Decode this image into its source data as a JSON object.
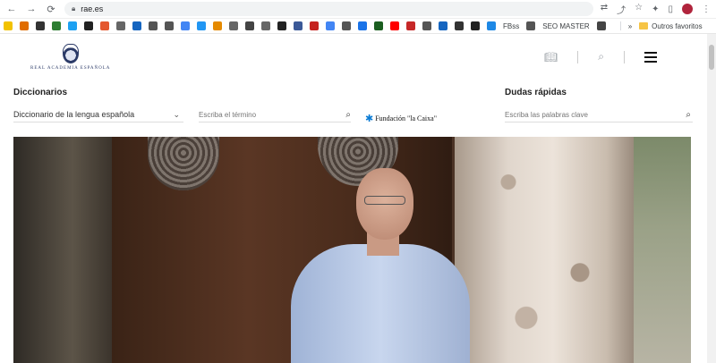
{
  "browser": {
    "url": "rae.es",
    "bookmarks": [
      {
        "color": "#f2c200"
      },
      {
        "color": "#e06c00"
      },
      {
        "color": "#333333"
      },
      {
        "color": "#2d7d32"
      },
      {
        "color": "#1da1f2"
      },
      {
        "color": "#222222"
      },
      {
        "color": "#e4572e"
      },
      {
        "color": "#666666"
      },
      {
        "color": "#1565c0"
      },
      {
        "color": "#555555"
      },
      {
        "color": "#555555"
      },
      {
        "color": "#4285f4"
      },
      {
        "color": "#2196f3"
      },
      {
        "color": "#e58a00"
      },
      {
        "color": "#666666"
      },
      {
        "color": "#444444"
      },
      {
        "color": "#666666"
      },
      {
        "color": "#222222"
      },
      {
        "color": "#3b5998"
      },
      {
        "color": "#c5221f"
      },
      {
        "color": "#4285f4"
      },
      {
        "color": "#555555"
      },
      {
        "color": "#1a73e8"
      },
      {
        "color": "#1b5e20"
      },
      {
        "color": "#ff0000"
      },
      {
        "color": "#c62828"
      },
      {
        "color": "#555555"
      },
      {
        "color": "#1565c0"
      },
      {
        "color": "#333333"
      },
      {
        "color": "#222222"
      },
      {
        "color": "#1e88e5"
      },
      {
        "color": "#555555"
      },
      {
        "color": "#444444"
      }
    ],
    "bookmark_labeled_1": "FBss",
    "bookmark_labeled_2": "SEO MASTER",
    "overflow": "»",
    "other_bookmarks": "Outros favoritos"
  },
  "header": {
    "logo_text": "REAL ACADEMIA ESPAÑOLA"
  },
  "search": {
    "dictionaries_title": "Diccionarios",
    "dictionary_selected": "Diccionario de la lengua española",
    "term_placeholder": "Escriba el término",
    "sponsor": "Fundación \"la Caixa\"",
    "doubts_title": "Dudas rápidas",
    "doubts_placeholder": "Escriba las palabras clave"
  }
}
